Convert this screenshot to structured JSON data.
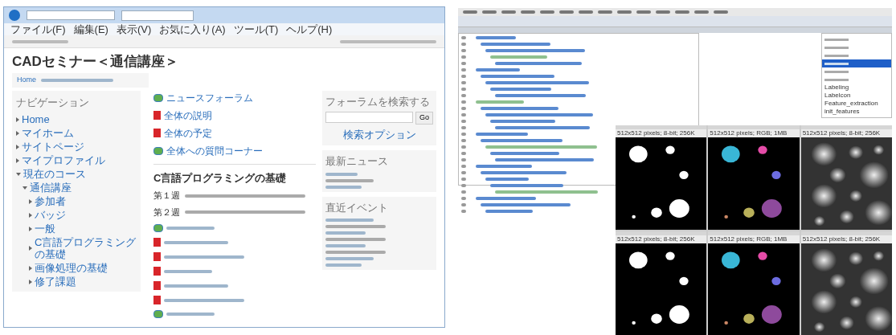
{
  "browser": {
    "menu": [
      "ファイル(F)",
      "編集(E)",
      "表示(V)",
      "お気に入り(A)",
      "ツール(T)",
      "ヘルプ(H)"
    ],
    "course_title": "CADセミナー＜通信講座＞",
    "breadcrumb": [
      "Home"
    ],
    "navigation": {
      "title": "ナビゲーション",
      "items": [
        {
          "label": "Home"
        },
        {
          "label": "マイホーム"
        },
        {
          "label": "サイトページ"
        },
        {
          "label": "マイプロファイル"
        },
        {
          "label": "現在のコース",
          "children": [
            {
              "label": "通信講座",
              "children": [
                {
                  "label": "参加者"
                },
                {
                  "label": "バッジ"
                },
                {
                  "label": "一般"
                },
                {
                  "label": "C言語プログラミングの基礎"
                },
                {
                  "label": "画像処理の基礎"
                },
                {
                  "label": "修了課題"
                }
              ]
            }
          ]
        }
      ]
    },
    "top_activities": [
      {
        "kind": "forum",
        "label": "ニュースフォーラム"
      },
      {
        "kind": "file",
        "label": "全体の説明"
      },
      {
        "kind": "file",
        "label": "全体の予定"
      },
      {
        "kind": "forum",
        "label": "全体への質問コーナー"
      }
    ],
    "section": {
      "title": "C言語プログラミングの基礎",
      "weeks": [
        "第１週",
        "第２週"
      ],
      "activities": [
        {
          "kind": "forum"
        },
        {
          "kind": "file"
        },
        {
          "kind": "file"
        },
        {
          "kind": "file"
        },
        {
          "kind": "file"
        },
        {
          "kind": "file"
        },
        {
          "kind": "forum"
        }
      ]
    },
    "search_block": {
      "title": "フォーラムを検索する",
      "button": "Go",
      "link": "検索オプション"
    },
    "news_block": {
      "title": "最新ニュース"
    },
    "events_block": {
      "title": "直近イベント"
    }
  },
  "editor": {
    "outline": [
      {
        "selected": false
      },
      {
        "selected": false
      },
      {
        "selected": false
      },
      {
        "selected": true
      },
      {
        "selected": false
      },
      {
        "selected": false
      },
      {
        "label": "Labeling",
        "selected": false
      },
      {
        "label": "Labelcon",
        "selected": false
      },
      {
        "label": "Feature_extraction",
        "selected": false
      },
      {
        "label": "init_features",
        "selected": false
      }
    ]
  },
  "image_windows": [
    {
      "kind": "binary",
      "info": "512x512 pixels; 8-bit; 256K"
    },
    {
      "kind": "color",
      "info": "512x512 pixels; RGB; 1MB"
    },
    {
      "kind": "gray",
      "info": "512x512 pixels; 8-bit; 256K"
    },
    {
      "kind": "binary",
      "info": "512x512 pixels; 8-bit; 256K"
    },
    {
      "kind": "color",
      "info": "512x512 pixels; RGB; 1MB"
    },
    {
      "kind": "gray",
      "info": "512x512 pixels; 8-bit; 256K"
    }
  ]
}
